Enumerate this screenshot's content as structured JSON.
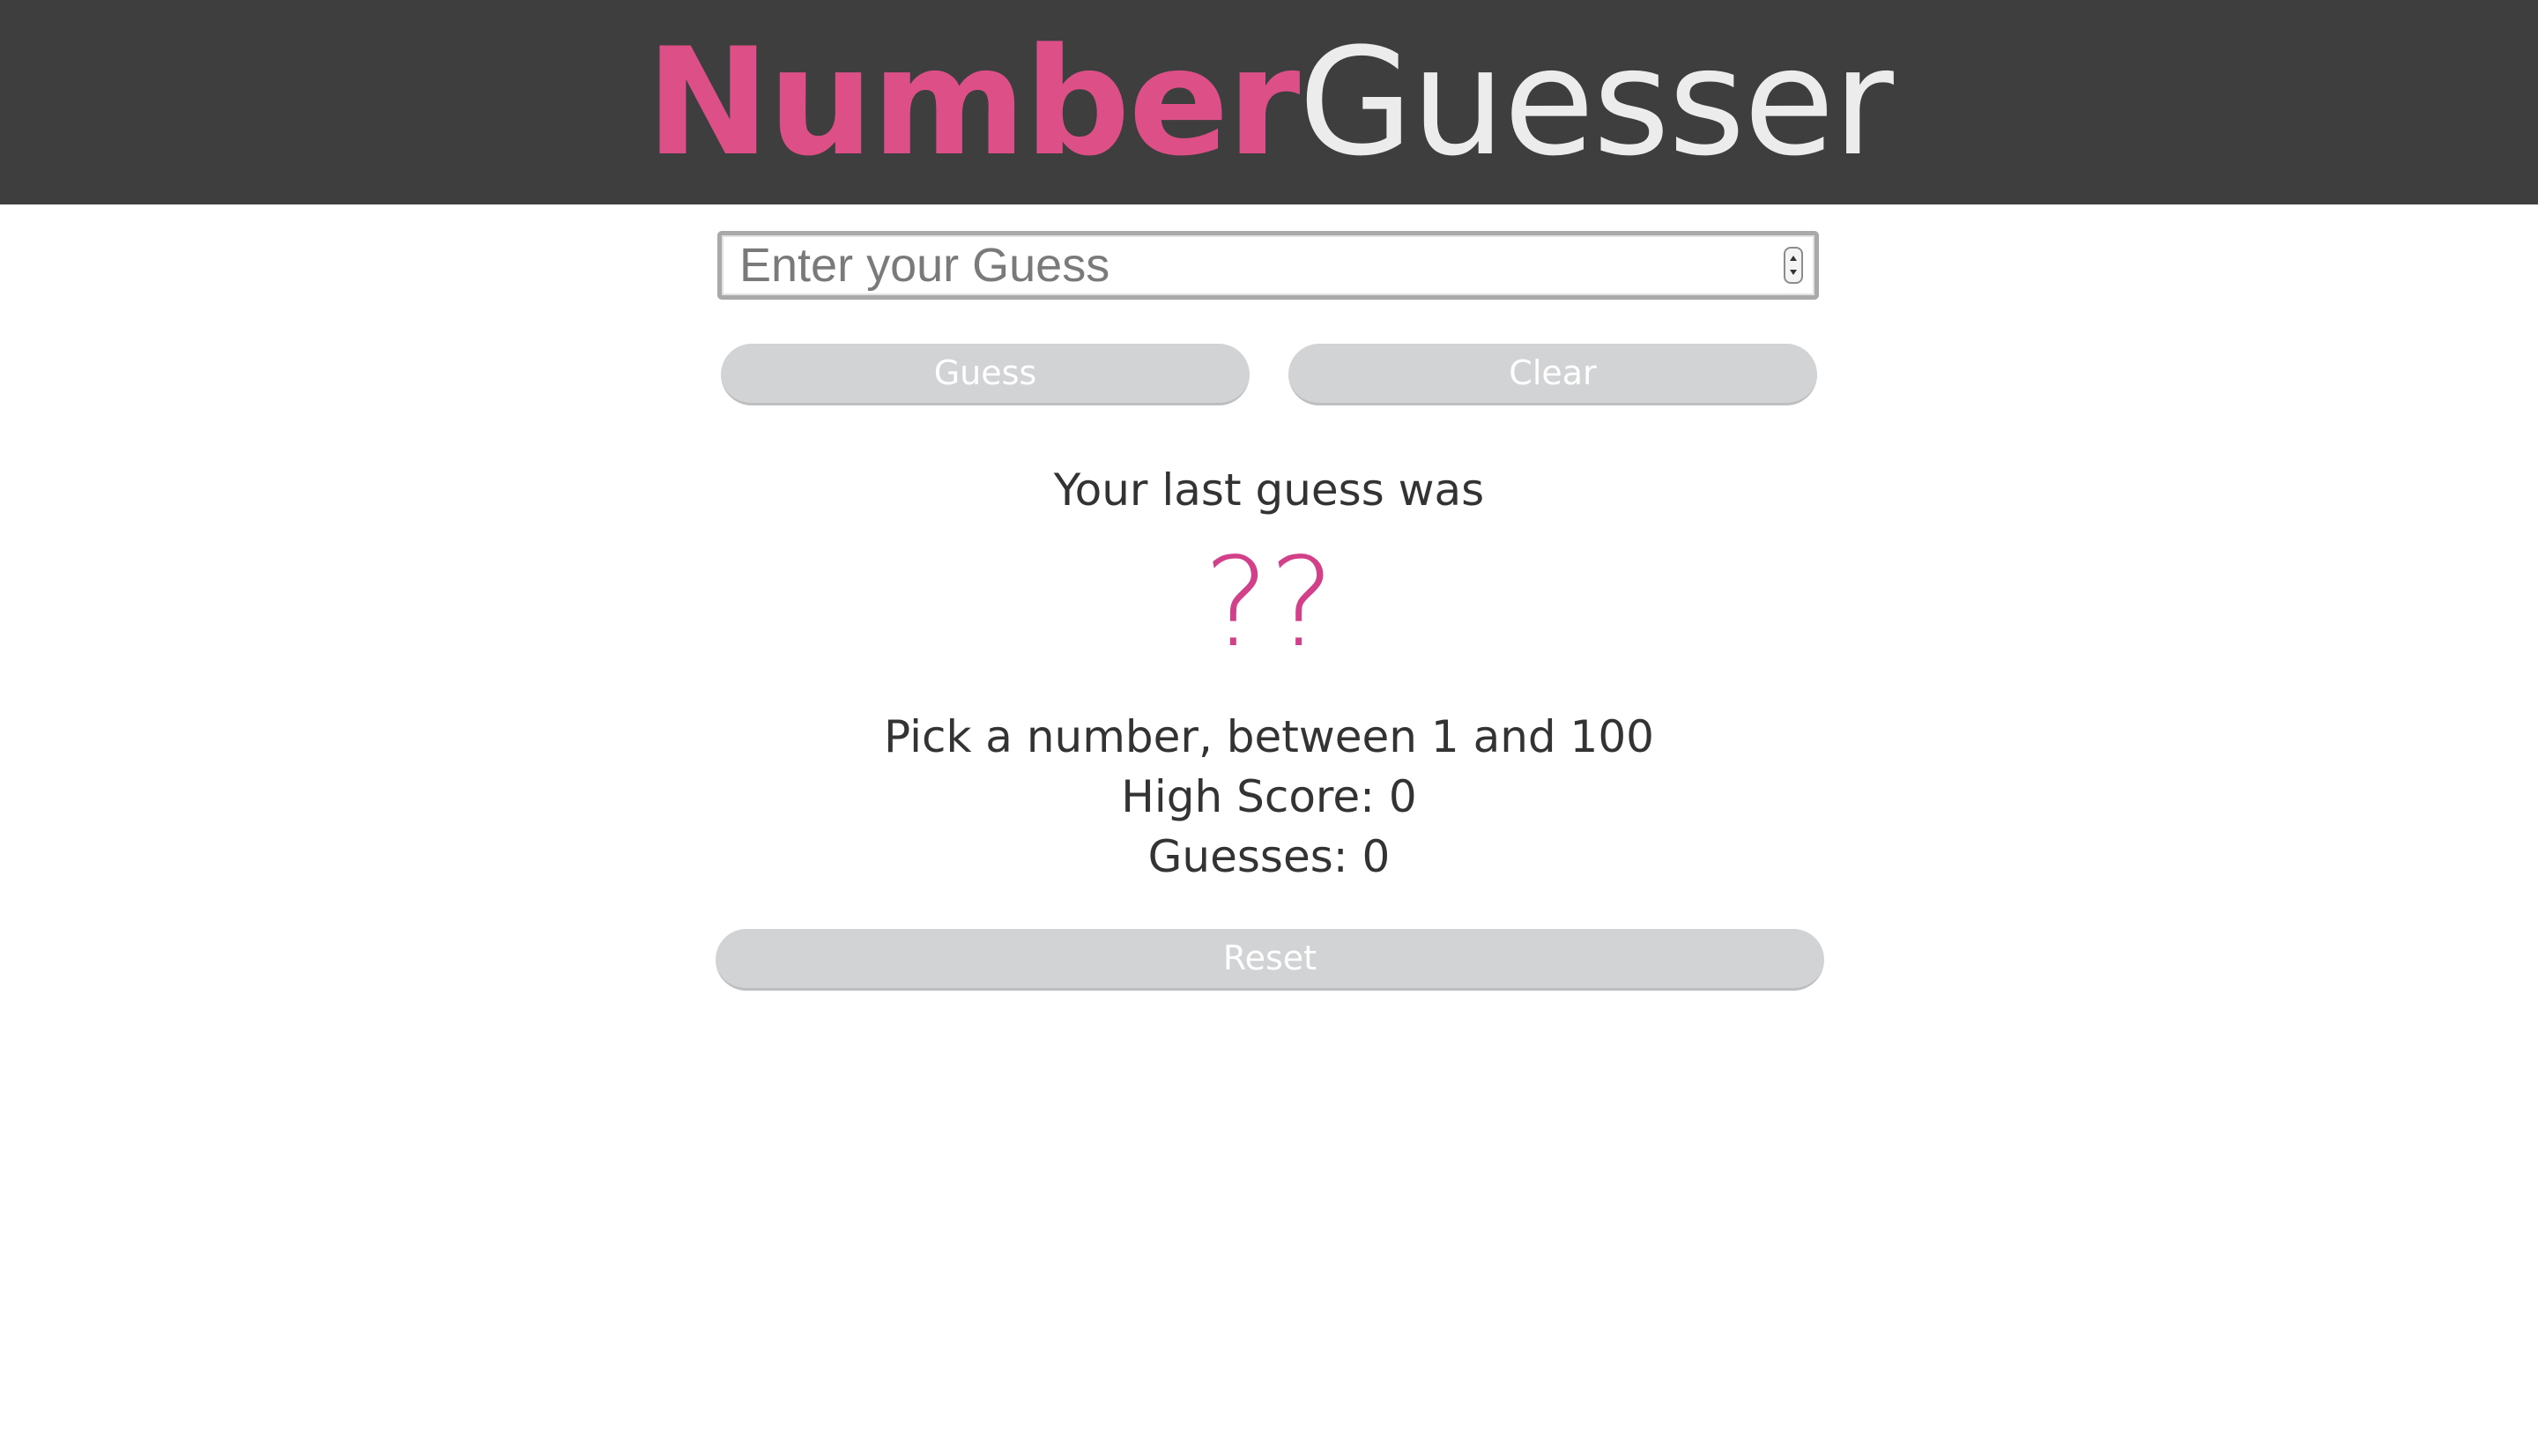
{
  "header": {
    "title_bold": "Number",
    "title_light": "Guesser"
  },
  "guess_form": {
    "input_value": "",
    "input_placeholder": "Enter your Guess",
    "guess_button_label": "Guess",
    "clear_button_label": "Clear"
  },
  "result": {
    "last_guess_label": "Your last guess was",
    "last_guess_value": "??",
    "hint": "Pick a number, between 1 and 100",
    "high_score": "High Score: 0",
    "guesses": "Guesses: 0"
  },
  "reset_button_label": "Reset",
  "colors": {
    "header_background": "#3e3e3e",
    "accent_pink": "#dc5087",
    "title_light": "#ececec",
    "button_gray": "#d2d3d5",
    "text_dark": "#333333"
  }
}
